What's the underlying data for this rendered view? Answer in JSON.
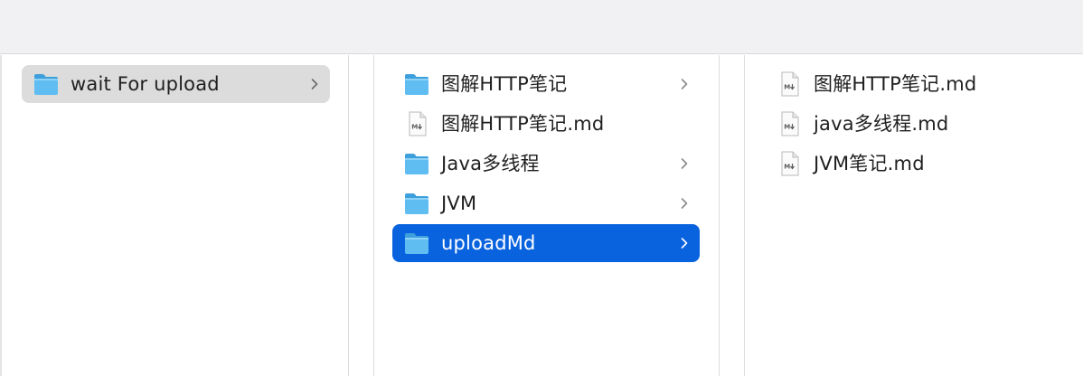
{
  "columns": [
    {
      "items": [
        {
          "label": "wait For upload",
          "kind": "folder",
          "state": "selected-inactive"
        }
      ]
    },
    {
      "items": [
        {
          "label": "图解HTTP笔记",
          "kind": "folder",
          "state": "normal"
        },
        {
          "label": "图解HTTP笔记.md",
          "kind": "markdown-file",
          "state": "normal"
        },
        {
          "label": "Java多线程",
          "kind": "folder",
          "state": "normal"
        },
        {
          "label": "JVM",
          "kind": "folder",
          "state": "normal"
        },
        {
          "label": "uploadMd",
          "kind": "folder",
          "state": "selected-active"
        }
      ]
    },
    {
      "items": [
        {
          "label": "图解HTTP笔记.md",
          "kind": "markdown-file",
          "state": "normal"
        },
        {
          "label": "java多线程.md",
          "kind": "markdown-file",
          "state": "normal"
        },
        {
          "label": "JVM笔记.md",
          "kind": "markdown-file",
          "state": "normal"
        }
      ]
    }
  ],
  "colors": {
    "selection_active": "#0a63de",
    "selection_inactive": "#dcdcdc",
    "folder": "#5ab8f0",
    "toolbar": "#f1f1f3"
  },
  "icons": {
    "folder": "folder-icon",
    "markdown_file": "markdown-file-icon",
    "chevron": "chevron-right-icon"
  }
}
